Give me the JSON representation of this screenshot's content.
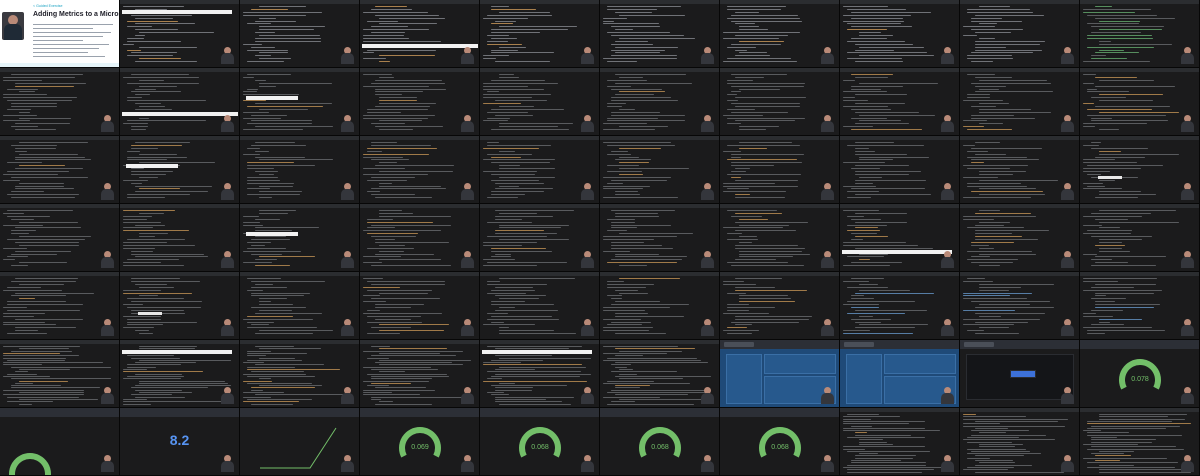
{
  "title_slide": {
    "breadcrumb": "< Guided Exercise",
    "title": "Adding Metrics to a Microservice"
  },
  "panels": {
    "stat_value": "8.2",
    "gauge_values": [
      "0.069",
      "0.068",
      "0.068",
      "0.068",
      "0.078"
    ]
  },
  "colors": {
    "terminal_bg": "#1b1b1c",
    "code_text": "#8d9096",
    "highlight_bar": "#f2f2f2",
    "gauge_green": "#73bf69",
    "stat_blue": "#5794f2",
    "dashboard_blue": "#1f4a78",
    "slide_accent": "#1aa2c2"
  },
  "grid": {
    "columns": 10,
    "rows": 7,
    "thumbnails": [
      {
        "kind": "slide"
      },
      {
        "kind": "terminal",
        "tint": "light",
        "bar": "top"
      },
      {
        "kind": "terminal",
        "tint": "light"
      },
      {
        "kind": "terminal",
        "tint": "light",
        "bar": "mid"
      },
      {
        "kind": "terminal",
        "tint": "light"
      },
      {
        "kind": "terminal",
        "tint": "light"
      },
      {
        "kind": "terminal",
        "tint": "light"
      },
      {
        "kind": "terminal",
        "tint": "light"
      },
      {
        "kind": "terminal",
        "tint": "light"
      },
      {
        "kind": "terminal",
        "tint": "green"
      },
      {
        "kind": "terminal"
      },
      {
        "kind": "terminal",
        "bar": "mid"
      },
      {
        "kind": "terminal",
        "bar": "upper"
      },
      {
        "kind": "terminal"
      },
      {
        "kind": "terminal"
      },
      {
        "kind": "terminal"
      },
      {
        "kind": "terminal"
      },
      {
        "kind": "terminal"
      },
      {
        "kind": "terminal"
      },
      {
        "kind": "terminal"
      },
      {
        "kind": "terminal"
      },
      {
        "kind": "terminal",
        "bar": "upper"
      },
      {
        "kind": "terminal"
      },
      {
        "kind": "terminal"
      },
      {
        "kind": "terminal"
      },
      {
        "kind": "terminal"
      },
      {
        "kind": "terminal"
      },
      {
        "kind": "terminal"
      },
      {
        "kind": "terminal"
      },
      {
        "kind": "terminal",
        "bar": "small"
      },
      {
        "kind": "terminal"
      },
      {
        "kind": "terminal"
      },
      {
        "kind": "terminal",
        "bar": "upper"
      },
      {
        "kind": "terminal"
      },
      {
        "kind": "terminal"
      },
      {
        "kind": "terminal"
      },
      {
        "kind": "terminal"
      },
      {
        "kind": "terminal",
        "bar": "wide"
      },
      {
        "kind": "terminal"
      },
      {
        "kind": "terminal"
      },
      {
        "kind": "terminal"
      },
      {
        "kind": "terminal",
        "bar": "small"
      },
      {
        "kind": "terminal"
      },
      {
        "kind": "terminal"
      },
      {
        "kind": "terminal"
      },
      {
        "kind": "terminal"
      },
      {
        "kind": "terminal"
      },
      {
        "kind": "terminal",
        "tint": "mixed"
      },
      {
        "kind": "terminal",
        "tint": "mixed"
      },
      {
        "kind": "terminal",
        "tint": "mixed"
      },
      {
        "kind": "terminal",
        "tint": "dense"
      },
      {
        "kind": "terminal",
        "tint": "dense",
        "bar": "top"
      },
      {
        "kind": "terminal",
        "tint": "dense"
      },
      {
        "kind": "terminal",
        "tint": "dense"
      },
      {
        "kind": "terminal",
        "tint": "dense",
        "bar": "top"
      },
      {
        "kind": "terminal",
        "tint": "dense"
      },
      {
        "kind": "dashboard-blue"
      },
      {
        "kind": "dashboard-blue"
      },
      {
        "kind": "dashboard-dark"
      },
      {
        "kind": "gauge",
        "gauge_index": 4
      },
      {
        "kind": "gauge-partial"
      },
      {
        "kind": "stat"
      },
      {
        "kind": "graph"
      },
      {
        "kind": "gauge",
        "gauge_index": 0
      },
      {
        "kind": "gauge",
        "gauge_index": 1
      },
      {
        "kind": "gauge",
        "gauge_index": 2
      },
      {
        "kind": "gauge",
        "gauge_index": 3
      },
      {
        "kind": "terminal",
        "tint": "dense"
      },
      {
        "kind": "terminal",
        "tint": "dense"
      },
      {
        "kind": "terminal",
        "tint": "dense"
      }
    ]
  }
}
